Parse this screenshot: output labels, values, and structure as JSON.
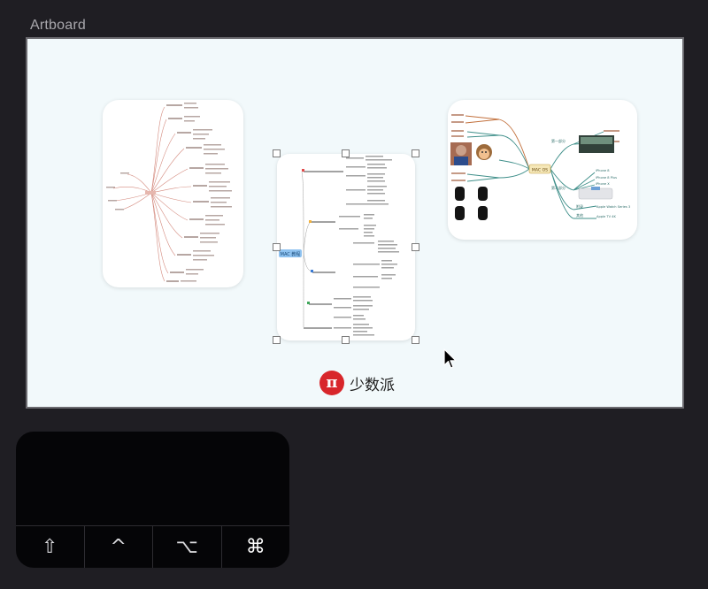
{
  "artboard": {
    "label": "Artboard"
  },
  "mindmaps": {
    "center_node": "MAC 教程",
    "right_center": "MAC OS",
    "right_branches": [
      "第一部分",
      "第二部分",
      "附录",
      "其他"
    ],
    "right_leaves": [
      "iPhone 8",
      "iPhone 8 Plus",
      "iPhone X",
      "Apple Watch Series 3",
      "Apple TV 4K"
    ]
  },
  "brand": {
    "text": "少数派",
    "logo_glyph": "π"
  },
  "keyboard": {
    "keys": [
      {
        "name": "shift-key",
        "glyph": "⇧"
      },
      {
        "name": "control-key",
        "glyph": "^"
      },
      {
        "name": "option-key",
        "glyph": "⌥"
      },
      {
        "name": "command-key",
        "glyph": "⌘"
      }
    ]
  },
  "colors": {
    "background": "#1f1e23",
    "artboard_bg": "#f2f9fb",
    "brand_red": "#d8262b",
    "keypad_bg": "#050507"
  }
}
